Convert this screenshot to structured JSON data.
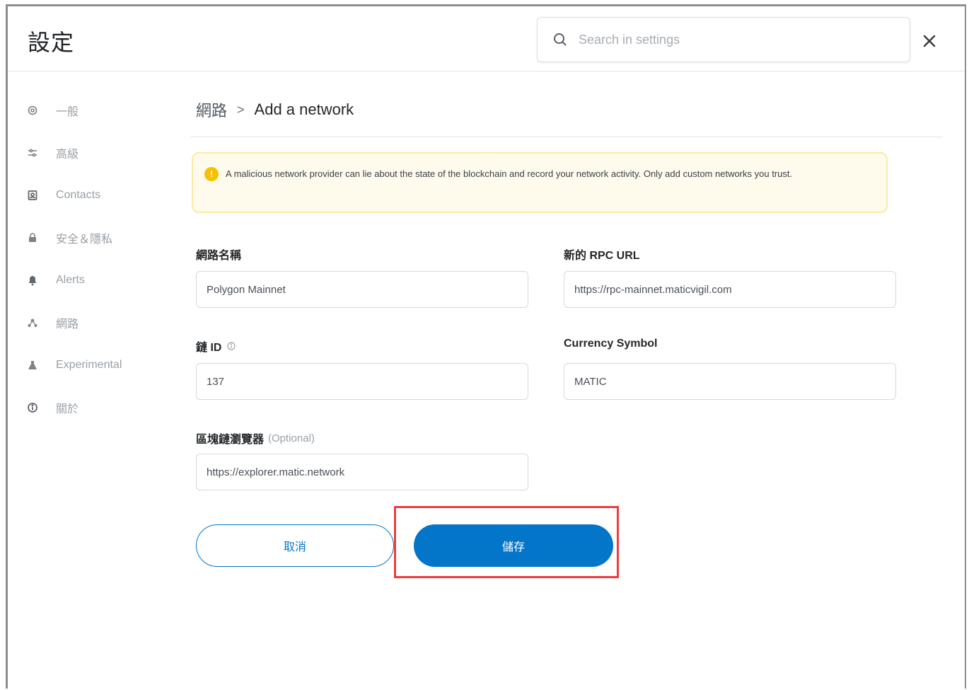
{
  "header": {
    "title": "設定",
    "search_placeholder": "Search in settings"
  },
  "sidebar": {
    "items": [
      {
        "label": "一般",
        "icon": "gear-icon"
      },
      {
        "label": "高級",
        "icon": "sliders-icon"
      },
      {
        "label": "Contacts",
        "icon": "contacts-icon"
      },
      {
        "label": "安全＆隱私",
        "icon": "lock-icon"
      },
      {
        "label": "Alerts",
        "icon": "bell-icon"
      },
      {
        "label": "網路",
        "icon": "network-icon"
      },
      {
        "label": "Experimental",
        "icon": "flask-icon"
      },
      {
        "label": "關於",
        "icon": "info-icon"
      }
    ]
  },
  "breadcrumb": {
    "parent": "網路",
    "separator": ">",
    "current": "Add a network"
  },
  "warning": {
    "icon_text": "!",
    "text": "A malicious network provider can lie about the state of the blockchain and record your network activity. Only add custom networks you trust."
  },
  "form": {
    "network_name": {
      "label": "網路名稱",
      "value": "Polygon Mainnet"
    },
    "rpc_url": {
      "label": "新的 RPC URL",
      "value": "https://rpc-mainnet.maticvigil.com"
    },
    "chain_id": {
      "label": "鏈 ID",
      "value": "137"
    },
    "currency_symbol": {
      "label": "Currency Symbol",
      "value": "MATIC"
    },
    "explorer_url": {
      "label": "區塊鏈瀏覽器",
      "optional": "(Optional)",
      "value": "https://explorer.matic.network"
    }
  },
  "buttons": {
    "cancel": "取消",
    "save": "儲存"
  },
  "colors": {
    "primary": "#0376c9",
    "warning_bg": "#fffbec",
    "warning_border": "#fde9a8",
    "highlight": "#f03c3c"
  }
}
